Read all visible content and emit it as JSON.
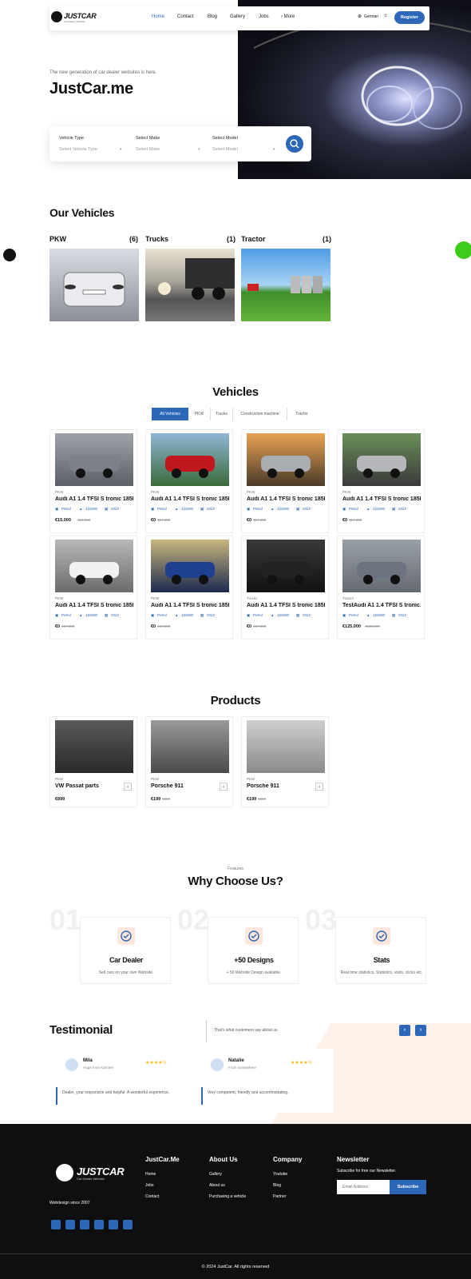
{
  "nav": {
    "logo": "JUSTCAR",
    "logo_sub": "Car Dealer Website",
    "items": [
      "Home",
      "Contact",
      "Blog",
      "Gallery",
      "Jobs",
      "› More"
    ],
    "language": "German",
    "register": "Register"
  },
  "hero": {
    "tagline": "The new generation of car dealer websites is here.",
    "title": "JustCar.me"
  },
  "search": {
    "fields": [
      {
        "label": "Vehicle Type",
        "value": "Select Vehicle Type"
      },
      {
        "label": "Select Make",
        "value": "Select Make"
      },
      {
        "label": "Select Model",
        "value": "Select Model"
      }
    ]
  },
  "our_vehicles": {
    "title": "Our Vehicles",
    "categories": [
      {
        "name": "PKW",
        "count": "(6)"
      },
      {
        "name": "Trucks",
        "count": "(1)"
      },
      {
        "name": "Tractor",
        "count": "(1)"
      }
    ]
  },
  "vehicles": {
    "title": "Vehicles",
    "tabs": [
      "All Vehicles",
      "PKW",
      "Trucks",
      "Construction machine",
      "Tractor"
    ],
    "cards": [
      {
        "sub": "PKW",
        "name": "Audi A1 1.4 TFSI S tronic 185PS...",
        "fuel": "Petrol",
        "km": "122000",
        "year": "2022",
        "price": "€15,000",
        "old": "€17,000"
      },
      {
        "sub": "PKW",
        "name": "Audi A1 1.4 TFSI S tronic 185PS...",
        "fuel": "Petrol",
        "km": "122000",
        "year": "2022",
        "price": "€0",
        "old": "€17,000"
      },
      {
        "sub": "PKW",
        "name": "Audi A1 1.4 TFSI S tronic 185PS...",
        "fuel": "Petrol",
        "km": "122000",
        "year": "2022",
        "price": "€0",
        "old": "€17,000"
      },
      {
        "sub": "PKW",
        "name": "Audi A1 1.4 TFSI S tronic 185PS...",
        "fuel": "Petrol",
        "km": "122000",
        "year": "2022",
        "price": "€0",
        "old": "€17,000"
      },
      {
        "sub": "PKW",
        "name": "Audi A1 1.4 TFSI S tronic 185PS...",
        "fuel": "Petrol",
        "km": "122000",
        "year": "2022",
        "price": "€0",
        "old": "€17,000"
      },
      {
        "sub": "PKW",
        "name": "Audi A1 1.4 TFSI S tronic 185PS...",
        "fuel": "Petrol",
        "km": "122000",
        "year": "2022",
        "price": "€0",
        "old": "€15,000"
      },
      {
        "sub": "Trucks",
        "name": "Audi A1 1.4 TFSI S tronic 185PS...",
        "fuel": "Petrol",
        "km": "122000",
        "year": "2022",
        "price": "€0",
        "old": "€17,000"
      },
      {
        "sub": "Tractor",
        "name": "TestAudi A1 1.4 TFSI S tronic...",
        "fuel": "Petrol",
        "km": "122000",
        "year": "2022",
        "price": "€125,000",
        "old": "€135,000"
      }
    ]
  },
  "products": {
    "title": "Products",
    "cards": [
      {
        "sub": "PKW",
        "name": "VW Passat parts",
        "price": "€899",
        "old": ""
      },
      {
        "sub": "PKW",
        "name": "Porsche 911",
        "price": "€199",
        "old": "€299"
      },
      {
        "sub": "PKW",
        "name": "Porsche 911",
        "price": "€199",
        "old": "€299"
      }
    ]
  },
  "why": {
    "eyebrow": "Features",
    "title": "Why Choose Us?",
    "items": [
      {
        "num": "01",
        "title": "Car Dealer",
        "text": "Sell cars on your own Website."
      },
      {
        "num": "02",
        "title": "+50 Designs",
        "text": "+ 50 Website Design available."
      },
      {
        "num": "03",
        "title": "Stats",
        "text": "Real time statistics, Statistics, visits, clicks etc."
      }
    ]
  },
  "testimonial": {
    "title": "Testimonial",
    "subtitle": "That's what customers say about us",
    "items": [
      {
        "name": "Mila",
        "role": "Huge from Kärnten",
        "text": "Dealer, your responsive and helpful. A wonderful experience."
      },
      {
        "name": "Natalie",
        "role": "From somewhere",
        "text": "Very competent, friendly and accommodating."
      }
    ]
  },
  "footer": {
    "logo": "JUSTCAR",
    "logo_sub": "Car Dealer Website",
    "since": "Webdesign since 2007",
    "cols": [
      {
        "title": "JustCar.Me",
        "links": [
          "Home",
          "Jobs",
          "Contact"
        ]
      },
      {
        "title": "About Us",
        "links": [
          "Gallery",
          "About us",
          "Purchasing a vehicle"
        ]
      },
      {
        "title": "Company",
        "links": [
          "Youtube",
          "Blog",
          "Partner"
        ]
      }
    ],
    "newsletter": {
      "title": "Newsletter",
      "text": "Subscribe for free our Newsletter.",
      "placeholder": "Email Address",
      "button": "Subscribe"
    },
    "copyright": "© 2024 JustCar. All rights reserved"
  },
  "colors": {
    "primary": "#2c67b8",
    "footer": "#0f0f12",
    "chat": "#3ecb1b"
  }
}
